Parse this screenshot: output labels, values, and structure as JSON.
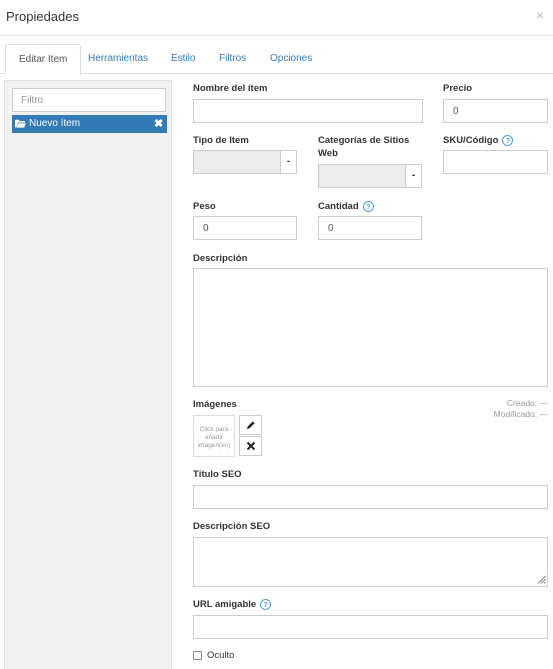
{
  "dialog": {
    "title": "Propiedades",
    "close_glyph": "×"
  },
  "tabs": [
    {
      "label": "Editar Item",
      "active": true
    },
    {
      "label": "Herramientas",
      "active": false
    },
    {
      "label": "Estilo",
      "active": false
    },
    {
      "label": "Filtros",
      "active": false
    },
    {
      "label": "Opciones",
      "active": false
    }
  ],
  "sidebar": {
    "filter_placeholder": "Filtro",
    "items": [
      {
        "label": "Nuevo ítem",
        "icon": "folder-open-icon",
        "remove_glyph": "✖"
      }
    ]
  },
  "form": {
    "name": {
      "label": "Nombre del ítem",
      "value": ""
    },
    "price": {
      "label": "Precio",
      "value": "0"
    },
    "item_type": {
      "label": "Tipo de Item",
      "value": "",
      "caret": "-"
    },
    "site_categories": {
      "label": "Categorías de Sitios Web",
      "value": "",
      "caret": "-"
    },
    "sku": {
      "label": "SKU/Código",
      "value": "",
      "help": "?"
    },
    "weight": {
      "label": "Peso",
      "value": "0"
    },
    "quantity": {
      "label": "Cantidad",
      "value": "0",
      "help": "?"
    },
    "description": {
      "label": "Descripción",
      "value": ""
    },
    "images": {
      "label": "Imágenes",
      "upload_text": "Click para añadir imagen(es)",
      "edit_icon": "pencil-icon",
      "delete_icon": "close-icon"
    },
    "meta": {
      "created": "Creado: —",
      "modified": "Modificado: —"
    },
    "seo_title": {
      "label": "Título SEO",
      "value": ""
    },
    "seo_description": {
      "label": "Descripción SEO",
      "value": ""
    },
    "friendly_url": {
      "label": "URL amigable",
      "value": "",
      "help": "?"
    },
    "hidden": {
      "label": "Oculto",
      "checked": false
    }
  },
  "colors": {
    "accent": "#337ab7",
    "help": "#4a9fd5",
    "sidebar_bg": "#f2f2f2"
  }
}
